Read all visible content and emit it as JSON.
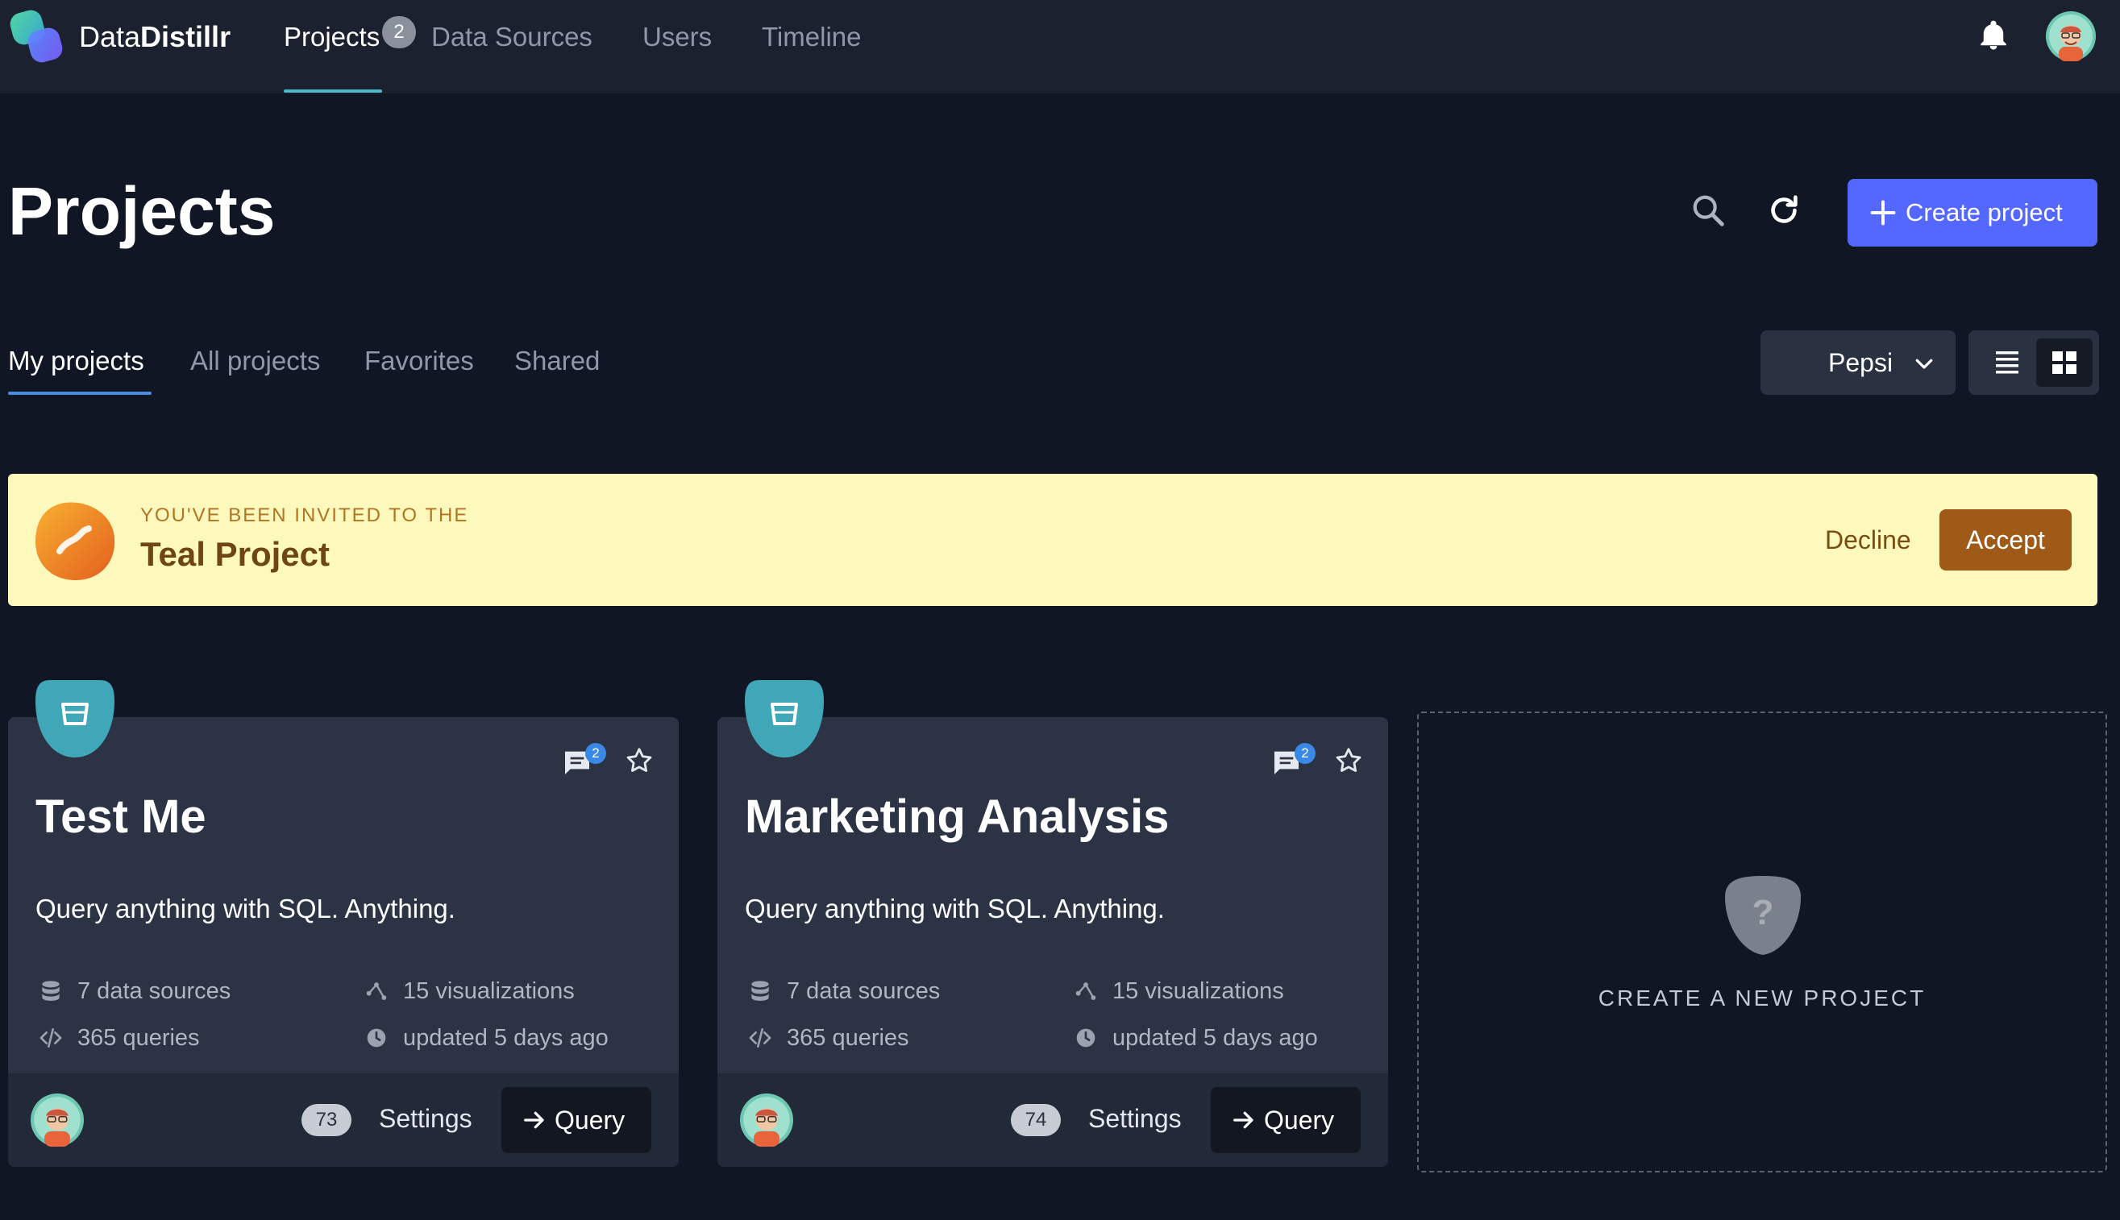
{
  "app": {
    "brand_prefix": "Data",
    "brand_suffix": "Distillr"
  },
  "nav": {
    "items": [
      {
        "label": "Projects",
        "badge": "2",
        "active": true
      },
      {
        "label": "Data Sources"
      },
      {
        "label": "Users"
      },
      {
        "label": "Timeline"
      }
    ]
  },
  "page": {
    "title": "Projects",
    "create_label": "Create project"
  },
  "tabs": [
    {
      "label": "My projects",
      "active": true
    },
    {
      "label": "All projects"
    },
    {
      "label": "Favorites"
    },
    {
      "label": "Shared"
    }
  ],
  "org_select": {
    "value": "Pepsi"
  },
  "invite": {
    "subtitle": "YOU'VE BEEN INVITED TO THE",
    "project": "Teal Project",
    "decline_label": "Decline",
    "accept_label": "Accept"
  },
  "projects": [
    {
      "title": "Test Me",
      "description": "Query anything with SQL. Anything.",
      "comments": "2",
      "data_sources": "7 data sources",
      "visualizations": "15 visualizations",
      "queries": "365 queries",
      "updated": "updated 5 days ago",
      "count": "73",
      "settings_label": "Settings",
      "query_label": "Query"
    },
    {
      "title": "Marketing Analysis",
      "description": "Query anything with SQL. Anything.",
      "comments": "2",
      "data_sources": "7 data sources",
      "visualizations": "15 visualizations",
      "queries": "365 queries",
      "updated": "updated 5 days ago",
      "count": "74",
      "settings_label": "Settings",
      "query_label": "Query"
    }
  ],
  "new_project": {
    "label": "CREATE A NEW PROJECT"
  },
  "colors": {
    "background": "#111624",
    "topbar": "#1b212e",
    "accent": "#5468ff",
    "card": "#2b3344",
    "invite_bg": "#fdf9bd",
    "invite_accept": "#9e5a16",
    "teal_icon": "#3fa7b8"
  },
  "icons": [
    "app-logo",
    "bell-icon",
    "avatar",
    "search-icon",
    "refresh-icon",
    "plus-icon",
    "chevron-down-icon",
    "list-view-icon",
    "grid-view-icon",
    "invite-project-icon",
    "project-cup-icon",
    "chat-icon",
    "star-icon",
    "database-icon",
    "visualization-icon",
    "code-icon",
    "clock-icon",
    "arrow-right-icon",
    "question-shield-icon"
  ]
}
